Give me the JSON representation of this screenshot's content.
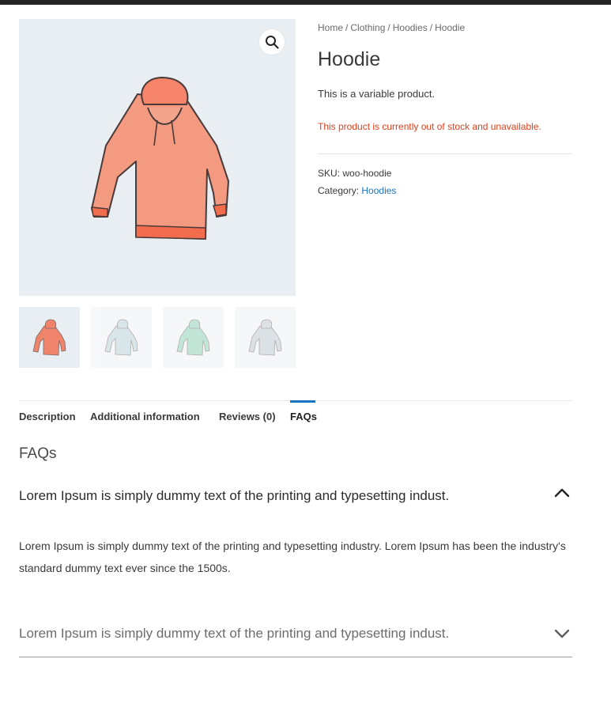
{
  "breadcrumb": {
    "items": [
      "Home",
      "Clothing",
      "Hoodies",
      "Hoodie"
    ],
    "separator": "/"
  },
  "product": {
    "title": "Hoodie",
    "short_description": "This is a variable product.",
    "stock_message": "This product is currently out of stock and unavailable.",
    "sku_label": "SKU:",
    "sku_value": "woo-hoodie",
    "category_label": "Category:",
    "category_value": "Hoodies"
  },
  "gallery": {
    "zoom_icon": "magnifier-icon",
    "thumbnails": [
      {
        "color": "#f0846a",
        "name": "hoodie-pink"
      },
      {
        "color": "#b9d3da",
        "name": "hoodie-blue"
      },
      {
        "color": "#8fd1b8",
        "name": "hoodie-green"
      },
      {
        "color": "#bfc9cf",
        "name": "hoodie-grey-logo"
      }
    ]
  },
  "tabs": [
    {
      "label": "Description",
      "active": false
    },
    {
      "label": "Additional information",
      "active": false
    },
    {
      "label": "Reviews (0)",
      "active": false
    },
    {
      "label": "FAQs",
      "active": true
    }
  ],
  "faqs": {
    "heading": "FAQs",
    "items": [
      {
        "question": "Lorem Ipsum is simply dummy text of the printing and typesetting indust.",
        "answer": "Lorem Ipsum is simply dummy text of the printing and typesetting industry. Lorem Ipsum has been the industry's standard dummy text ever since the 1500s.",
        "expanded": true,
        "icon": "chevron-up-icon"
      },
      {
        "question": "Lorem Ipsum is simply dummy text of the printing and typesetting indust.",
        "expanded": false,
        "icon": "chevron-down-icon"
      }
    ]
  },
  "colors": {
    "accent": "#1e73be",
    "stock_red": "#e2401c",
    "image_bg": "#e9eef2"
  }
}
